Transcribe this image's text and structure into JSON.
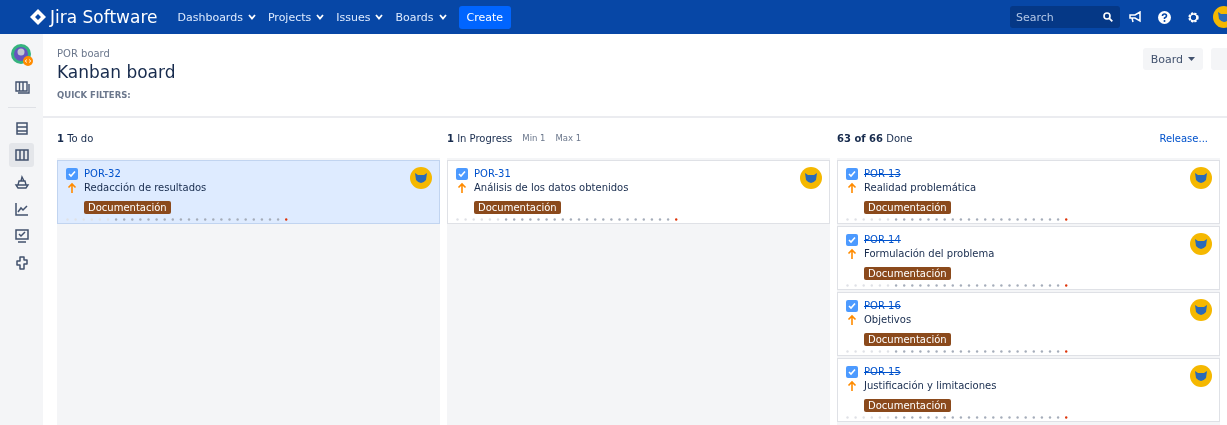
{
  "nav": {
    "product": "Jira Software",
    "menus": [
      {
        "label": "Dashboards"
      },
      {
        "label": "Projects"
      },
      {
        "label": "Issues"
      },
      {
        "label": "Boards"
      }
    ],
    "create": "Create",
    "search": {
      "placeholder": "Search"
    }
  },
  "sidebar": {
    "items": [
      {
        "selected": false
      },
      {
        "selected": true
      },
      {
        "selected": false
      },
      {
        "selected": false
      },
      {
        "selected": false
      },
      {
        "selected": false
      }
    ]
  },
  "header": {
    "breadcrumb": "POR board",
    "title": "Kanban board",
    "quick_filters": "QUICK FILTERS:",
    "board_button": "Board"
  },
  "columns": [
    {
      "count": "1",
      "name": "To do",
      "cards": [
        {
          "key": "POR-32",
          "summary": "Redacción de resultados",
          "label": "Documentación",
          "done": false,
          "selected": true
        }
      ]
    },
    {
      "count": "1",
      "name": "In Progress",
      "min": "Min 1",
      "max": "Max 1",
      "cards": [
        {
          "key": "POR-31",
          "summary": "Análisis de los datos obtenidos",
          "label": "Documentación",
          "done": false,
          "selected": false
        }
      ]
    },
    {
      "count": "63 of 66",
      "name": "Done",
      "action": "Release...",
      "cards": [
        {
          "key": "POR-13",
          "summary": "Realidad problemática",
          "label": "Documentación",
          "done": true,
          "selected": false
        },
        {
          "key": "POR-14",
          "summary": "Formulación del problema",
          "label": "Documentación",
          "done": true,
          "selected": false
        },
        {
          "key": "POR-16",
          "summary": "Objetivos",
          "label": "Documentación",
          "done": true,
          "selected": false
        },
        {
          "key": "POR-15",
          "summary": "Justificación y limitaciones",
          "label": "Documentación",
          "done": true,
          "selected": false
        }
      ]
    }
  ]
}
